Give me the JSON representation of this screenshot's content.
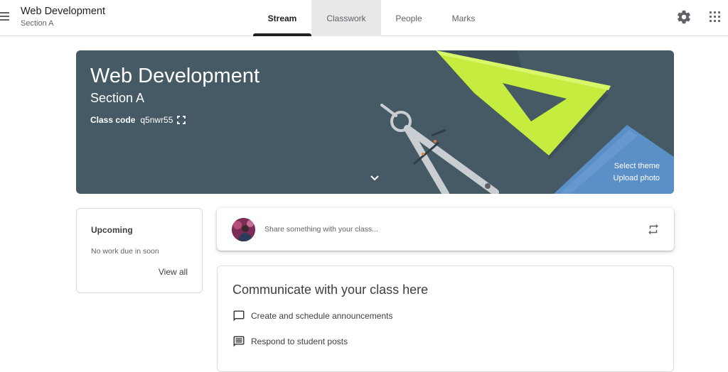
{
  "header": {
    "title": "Web Development",
    "subtitle": "Section A",
    "tabs": [
      {
        "label": "Stream"
      },
      {
        "label": "Classwork"
      },
      {
        "label": "People"
      },
      {
        "label": "Marks"
      }
    ]
  },
  "banner": {
    "title": "Web Development",
    "section": "Section A",
    "class_code_label": "Class code",
    "class_code": "q5nwr55",
    "select_theme": "Select theme",
    "upload_photo": "Upload photo",
    "background_color": "#455a64"
  },
  "upcoming": {
    "title": "Upcoming",
    "empty_text": "No work due in soon",
    "view_all": "View all"
  },
  "share": {
    "placeholder": "Share something with your class..."
  },
  "communicate": {
    "title": "Communicate with your class here",
    "items": [
      {
        "label": "Create and schedule announcements",
        "icon": "comment-icon"
      },
      {
        "label": "Respond to student posts",
        "icon": "message-icon"
      }
    ]
  },
  "icons": {
    "menu": "menu-icon",
    "settings": "gear-icon",
    "apps": "apps-grid-icon",
    "expand": "fullscreen-icon",
    "chevron": "chevron-down-icon",
    "repost": "repost-icon"
  }
}
